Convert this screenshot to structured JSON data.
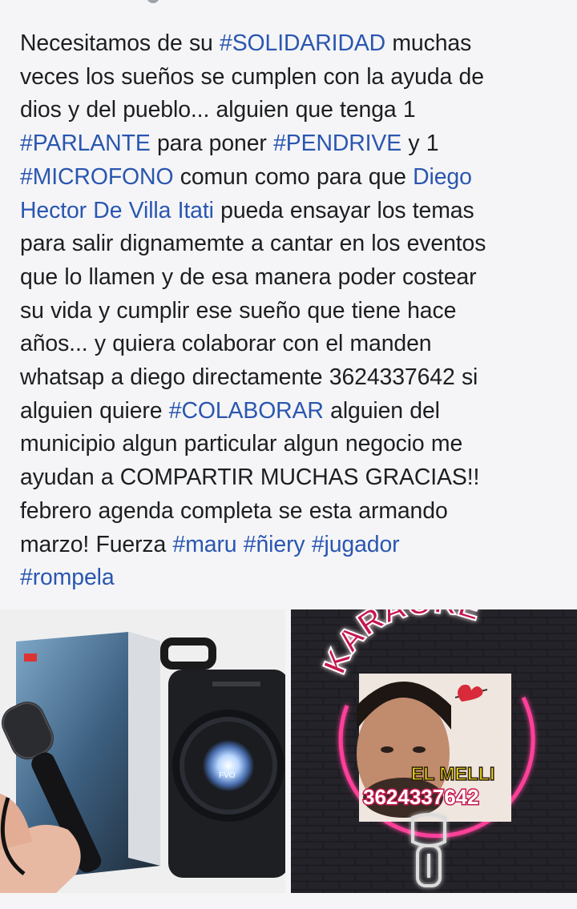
{
  "post": {
    "lines": [
      [
        {
          "t": "Necesitamos de su ",
          "k": "text"
        },
        {
          "t": "#SOLIDARIDAD",
          "k": "tag"
        },
        {
          "t": "  muchas",
          "k": "text"
        }
      ],
      [
        {
          "t": "veces los sueños se cumplen con la ayuda de",
          "k": "text"
        }
      ],
      [
        {
          "t": "dios y del pueblo... alguien que tenga 1",
          "k": "text"
        }
      ],
      [
        {
          "t": "#PARLANTE",
          "k": "tag"
        },
        {
          "t": "  para poner ",
          "k": "text"
        },
        {
          "t": "#PENDRIVE",
          "k": "tag"
        },
        {
          "t": "  y 1",
          "k": "text"
        }
      ],
      [
        {
          "t": "#MICROFONO",
          "k": "tag"
        },
        {
          "t": " comun como para que ",
          "k": "text"
        },
        {
          "t": "Diego",
          "k": "link"
        }
      ],
      [
        {
          "t": "Hector De Villa Itati",
          "k": "link"
        },
        {
          "t": "  pueda ensayar los temas",
          "k": "text"
        }
      ],
      [
        {
          "t": "para salir dignamemte a cantar en los eventos",
          "k": "text"
        }
      ],
      [
        {
          "t": "que lo llamen y de esa manera poder costear",
          "k": "text"
        }
      ],
      [
        {
          "t": "su vida y cumplir ese sueño que tiene hace",
          "k": "text"
        }
      ],
      [
        {
          "t": "años... y quiera colaborar con el manden",
          "k": "text"
        }
      ],
      [
        {
          "t": "whatsap a diego directamente 3624337642 si",
          "k": "text"
        }
      ],
      [
        {
          "t": "alguien quiere ",
          "k": "text"
        },
        {
          "t": "#COLABORAR",
          "k": "tag"
        },
        {
          "t": "  alguien del",
          "k": "text"
        }
      ],
      [
        {
          "t": "municipio algun particular algun negocio me",
          "k": "text"
        }
      ],
      [
        {
          "t": "ayudan a COMPARTIR MUCHAS GRACIAS!!",
          "k": "text"
        }
      ],
      [
        {
          "t": "febrero agenda completa se esta armando",
          "k": "text"
        }
      ],
      [
        {
          "t": "marzo! Fuerza ",
          "k": "text"
        },
        {
          "t": "#maru",
          "k": "tag"
        },
        {
          "t": " ",
          "k": "text"
        },
        {
          "t": "#ñiery",
          "k": "tag"
        },
        {
          "t": " ",
          "k": "text"
        },
        {
          "t": "#jugador",
          "k": "tag"
        }
      ],
      [
        {
          "t": "#rompela",
          "k": "tag"
        }
      ]
    ]
  },
  "media": {
    "left_image": {
      "description_icon": "speaker-microphone-photo",
      "speaker_label": "FVO"
    },
    "right_image": {
      "description_icon": "karaoke-neon-flyer",
      "neon_title": "KARAOKE",
      "name_label": "EL MELLI",
      "phone_label": "3624337642"
    }
  },
  "colors": {
    "hashtag": "#2a56b0",
    "text": "#1c1e21",
    "background": "#f5f5f7",
    "neon_pink": "#ff3f9a",
    "neon_title_fill": "#c7184f"
  }
}
